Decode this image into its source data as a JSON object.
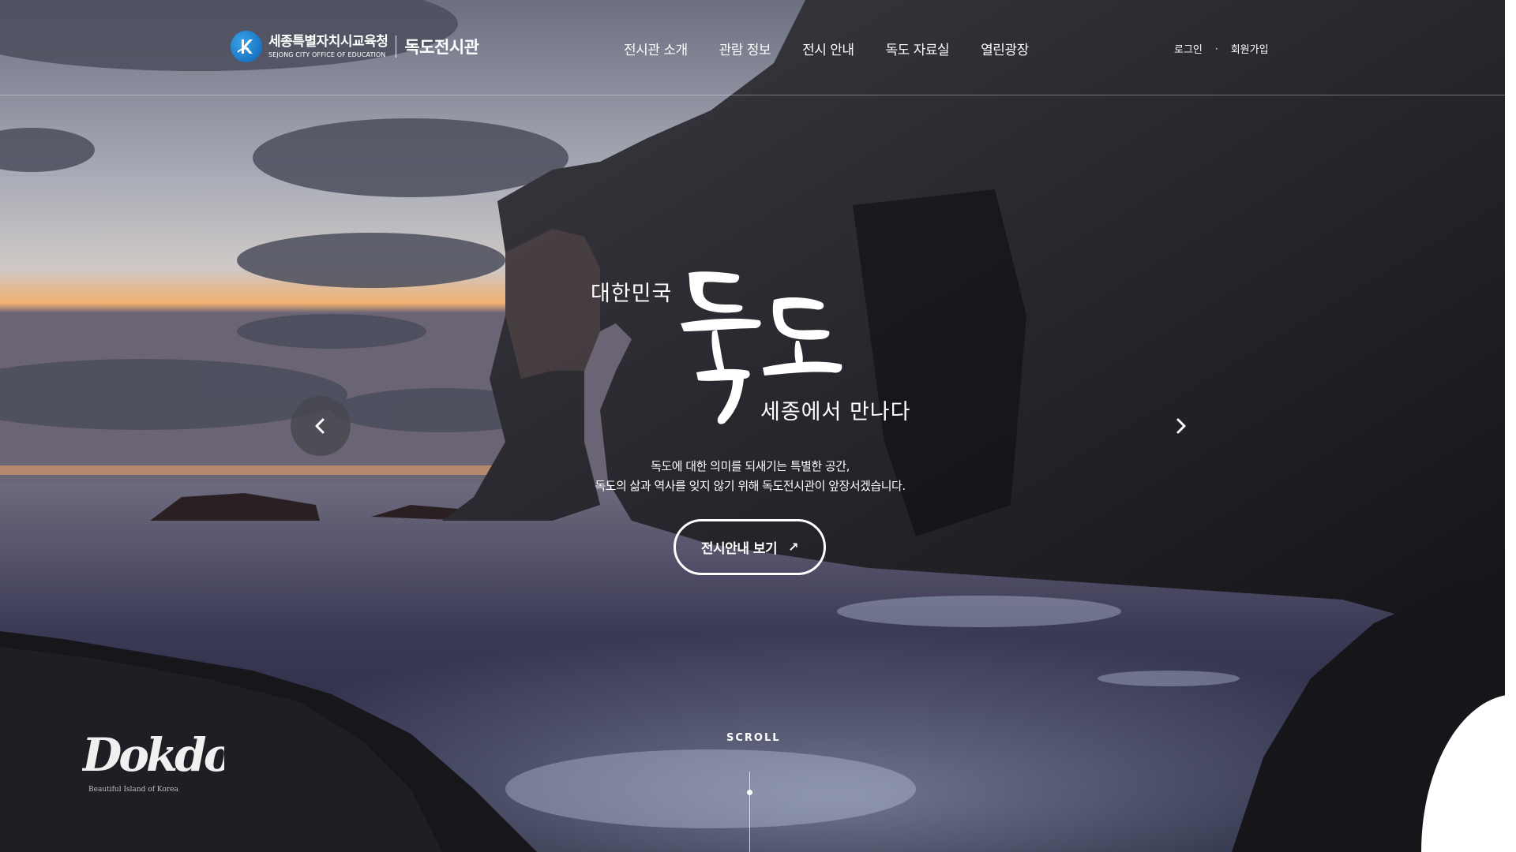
{
  "header": {
    "org_name_kr": "세종특별자치시교육청",
    "org_name_en": "SEJONG CITY OFFICE OF EDUCATION",
    "site_name": "독도전시관",
    "nav": [
      {
        "label": "전시관 소개"
      },
      {
        "label": "관람 정보"
      },
      {
        "label": "전시 안내"
      },
      {
        "label": "독도 자료실"
      },
      {
        "label": "열린광장"
      }
    ],
    "util": {
      "login": "로그인",
      "separator": "·",
      "signup": "회원가입"
    }
  },
  "hero": {
    "prefix": "대한민국",
    "calligraphy": "독도",
    "subtitle": "세종에서 만나다",
    "desc_line1": "독도에 대한 의미를 되새기는 특별한 공간,",
    "desc_line2": "독도의 삶과 역사를 잊지 않기 위해 독도전시관이 앞장서겠습니다.",
    "cta_label": "전시안내 보기",
    "cta_icon": "arrow-up-right-icon"
  },
  "carousel": {
    "prev_icon": "chevron-left-icon",
    "next_icon": "chevron-right-icon"
  },
  "scroll": {
    "label": "SCROLL"
  },
  "footer_logo": {
    "text": "Dokdo",
    "tagline": "Beautiful Island of Korea"
  },
  "colors": {
    "accent": "#ffffff",
    "logo_blue": "#1a7ad0"
  }
}
